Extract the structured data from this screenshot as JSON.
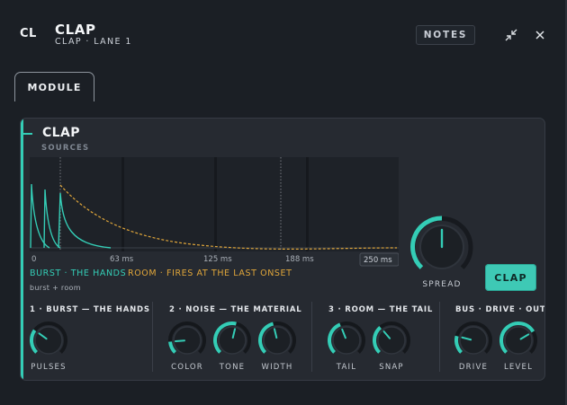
{
  "header": {
    "app_icon_text": "CL",
    "title": "CLAP",
    "subtitle": "CLAP · LANE 1",
    "notes_label": "NOTES"
  },
  "tabs": [
    {
      "label": "MODULE",
      "active": true
    }
  ],
  "module": {
    "title": "CLAP",
    "sources_label": "SOURCES",
    "scope": {
      "axis_labels": [
        "0",
        "63 ms",
        "125 ms",
        "188 ms",
        "250 ms"
      ],
      "burst_color": "#34cdb6",
      "room_color": "#e0a63a"
    },
    "legend": {
      "burst": "BURST · THE HANDS",
      "room": "ROOM · FIRES AT THE LAST ONSET",
      "note": "burst + room"
    },
    "spread": {
      "label": "SPREAD",
      "value": 0.5
    },
    "clap_button": "CLAP",
    "sections": [
      {
        "title": "1 · BURST — THE HANDS",
        "knobs": [
          {
            "label": "PULSES",
            "value": 0.3
          }
        ]
      },
      {
        "title": "2 · NOISE — THE MATERIAL",
        "knobs": [
          {
            "label": "COLOR",
            "value": 0.15
          },
          {
            "label": "TONE",
            "value": 0.55
          },
          {
            "label": "WIDTH",
            "value": 0.45
          }
        ]
      },
      {
        "title": "3 · ROOM — THE TAIL",
        "knobs": [
          {
            "label": "TAIL",
            "value": 0.42
          },
          {
            "label": "SNAP",
            "value": 0.35
          }
        ]
      },
      {
        "title": "BUS · DRIVE · OUT",
        "knobs": [
          {
            "label": "DRIVE",
            "value": 0.22
          },
          {
            "label": "LEVEL",
            "value": 0.72
          }
        ]
      }
    ]
  },
  "colors": {
    "accent": "#34cdb6",
    "room": "#e0a63a",
    "background": "#1b1f25",
    "panel": "#262a31"
  }
}
